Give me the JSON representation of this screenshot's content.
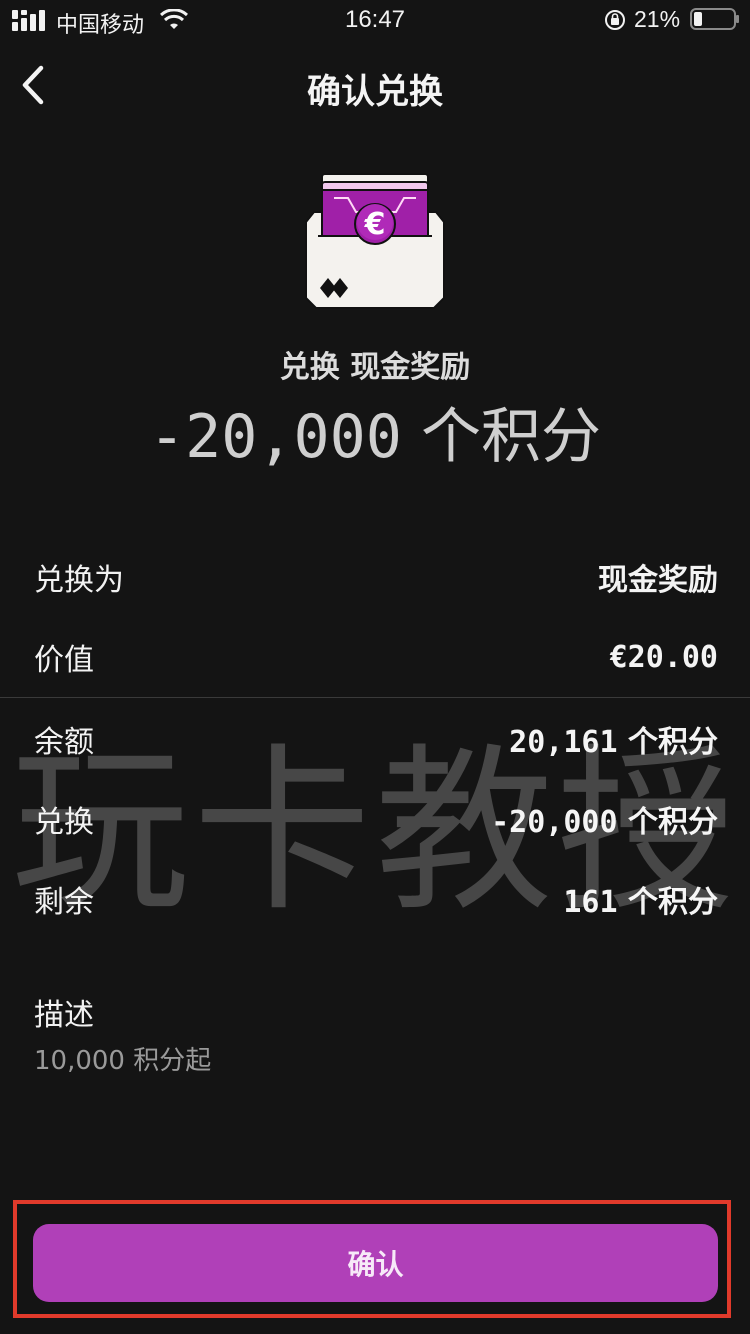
{
  "status_bar": {
    "carrier": "中国移动",
    "time": "16:47",
    "battery_percent": "21%"
  },
  "nav": {
    "title": "确认兑换"
  },
  "reward": {
    "redeem_label": "兑换 现金奖励",
    "points_amount": "-20,000",
    "points_unit": "个积分"
  },
  "details": {
    "redeem_for": {
      "label": "兑换为",
      "value": "现金奖励"
    },
    "worth": {
      "label": "价值",
      "value": "€20.00"
    },
    "balance": {
      "label": "余额",
      "amount": "20,161",
      "unit": "个积分"
    },
    "redeem": {
      "label": "兑换",
      "amount": "-20,000",
      "unit": "个积分"
    },
    "remaining": {
      "label": "剩余",
      "amount": "161",
      "unit": "个积分"
    }
  },
  "description": {
    "title": "描述",
    "text": "10,000 积分起"
  },
  "watermark": "玩卡教授",
  "confirm_button": {
    "label": "确认"
  },
  "colors": {
    "background": "#141414",
    "accent": "#b040b8",
    "highlight": "#e03a2b"
  },
  "icons": {
    "back": "chevron-left-icon",
    "card": "euro-cash-card-icon"
  }
}
